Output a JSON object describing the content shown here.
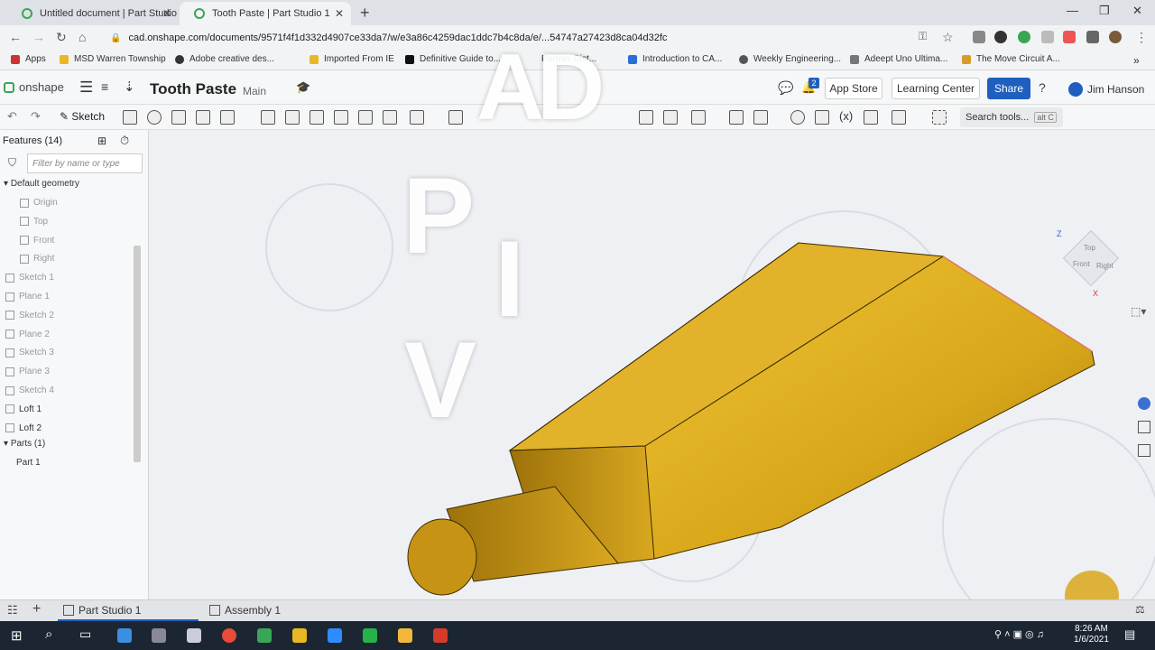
{
  "browser": {
    "tabs": [
      {
        "title": "Untitled document | Part Studio 1",
        "active": false
      },
      {
        "title": "Tooth Paste | Part Studio 1",
        "active": true
      }
    ],
    "url": "cad.onshape.com/documents/9571f4f1d332d4907ce33da7/w/e3a86c4259dac1ddc7b4c8da/e/...54747a27423d8ca04d32fc",
    "bookmarks": [
      "Apps",
      "MSD Warren Township",
      "Adobe creative des...",
      "Imported From IE",
      "Definitive Guide to...",
      "Partner Dist...",
      "Introduction to CA...",
      "Weekly Engineering...",
      "Adeept Uno Ultima...",
      "The Move Circuit A..."
    ]
  },
  "onshape": {
    "logo": "onshape",
    "doc_title": "Tooth Paste",
    "branch": "Main",
    "notification_count": "2",
    "app_store": "App Store",
    "learning_center": "Learning Center",
    "share": "Share",
    "user": "Jim Hanson",
    "sketch": "Sketch",
    "search_tools": "Search tools...",
    "search_shortcut": "alt C"
  },
  "feature_panel": {
    "header": "Features (14)",
    "filter_placeholder": "Filter by name or type",
    "default_geometry": "Default geometry",
    "items": [
      {
        "label": "Origin",
        "dim": true
      },
      {
        "label": "Top",
        "dim": true
      },
      {
        "label": "Front",
        "dim": true
      },
      {
        "label": "Right",
        "dim": true
      },
      {
        "label": "Sketch 1",
        "dim": true
      },
      {
        "label": "Plane 1",
        "dim": true
      },
      {
        "label": "Sketch 2",
        "dim": true
      },
      {
        "label": "Plane 2",
        "dim": true
      },
      {
        "label": "Sketch 3",
        "dim": true
      },
      {
        "label": "Plane 3",
        "dim": true
      },
      {
        "label": "Sketch 4",
        "dim": true
      },
      {
        "label": "Loft 1",
        "dim": false
      },
      {
        "label": "Loft 2",
        "dim": false
      }
    ],
    "parts_header": "Parts (1)",
    "parts": [
      "Part 1"
    ]
  },
  "viewcube": {
    "top": "Top",
    "front": "Front",
    "right": "Right",
    "axis_z": "Z",
    "axis_x": "X"
  },
  "overlay_letters": [
    "AD",
    "P",
    "I",
    "V"
  ],
  "bottom_tabs": [
    "Part Studio 1",
    "Assembly 1"
  ],
  "clock": {
    "time": "8:26 AM",
    "date": "1/6/2021"
  },
  "colors": {
    "part": "#d8a71a",
    "share": "#1f5fbf",
    "onshape_green": "#3aa655"
  }
}
